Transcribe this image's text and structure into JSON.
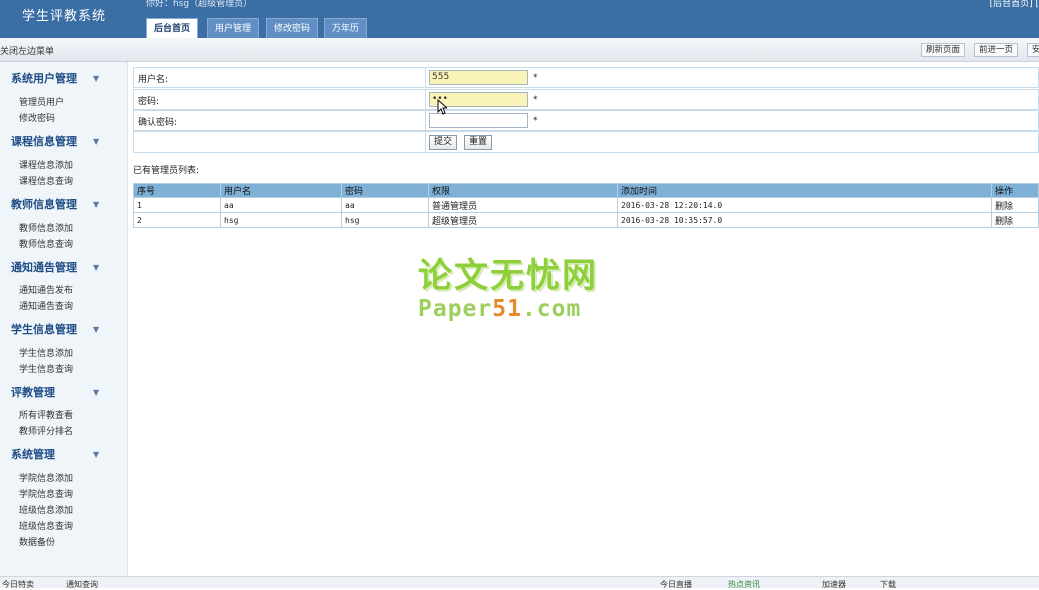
{
  "header": {
    "app_title": "学生评教系统",
    "welcome": "你好：hsg（超级管理员）",
    "top_right": "[后台首页] [",
    "tabs": [
      {
        "label": "后台首页",
        "active": true
      },
      {
        "label": "用户管理",
        "active": false
      },
      {
        "label": "修改密码",
        "active": false
      },
      {
        "label": "万年历",
        "active": false
      }
    ]
  },
  "toolbar": {
    "toggle_menu": "关闭左边菜单",
    "refresh": "刷新页面",
    "forward": "前进一页",
    "more": "安"
  },
  "sidebar": {
    "sections": [
      {
        "title": "系统用户管理",
        "items": [
          "管理员用户",
          "修改密码"
        ]
      },
      {
        "title": "课程信息管理",
        "items": [
          "课程信息添加",
          "课程信息查询"
        ]
      },
      {
        "title": "教师信息管理",
        "items": [
          "教师信息添加",
          "教师信息查询"
        ]
      },
      {
        "title": "通知通告管理",
        "items": [
          "通知通告发布",
          "通知通告查询"
        ]
      },
      {
        "title": "学生信息管理",
        "items": [
          "学生信息添加",
          "学生信息查询"
        ]
      },
      {
        "title": "评教管理",
        "items": [
          "所有评教查看",
          "教师评分排名"
        ]
      },
      {
        "title": "系统管理",
        "items": [
          "学院信息添加",
          "学院信息查询",
          "班级信息添加",
          "班级信息查询",
          "数据备份"
        ]
      }
    ]
  },
  "form": {
    "username_label": "用户名:",
    "username_value": "555",
    "password_label": "密码:",
    "password_value": "•••",
    "confirm_label": "确认密码:",
    "confirm_value": "",
    "required_mark": "*",
    "submit": "提交",
    "reset": "重置"
  },
  "admin_list": {
    "title": "已有管理员列表:",
    "columns": [
      "序号",
      "用户名",
      "密码",
      "权限",
      "添加时间",
      "操作"
    ],
    "rows": [
      {
        "no": "1",
        "username": "aa",
        "password": "aa",
        "role": "普通管理员",
        "added": "2016-03-28 12:20:14.0",
        "action": "删除"
      },
      {
        "no": "2",
        "username": "hsg",
        "password": "hsg",
        "role": "超级管理员",
        "added": "2016-03-28 10:35:57.0",
        "action": "删除"
      }
    ]
  },
  "watermark": {
    "cn": "论文无忧网",
    "en_a": "Paper",
    "en_b": "51",
    "en_c": ".com"
  },
  "statusbar": {
    "left1": "今日特卖",
    "left2": "通知查询",
    "right1": "今日直播",
    "right2": "热点资讯",
    "right3": "加速器",
    "right4": "下载"
  }
}
